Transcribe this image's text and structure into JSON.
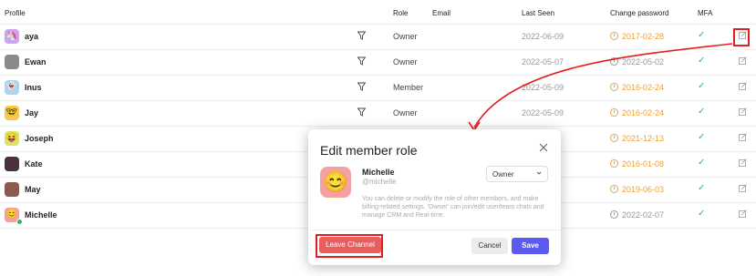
{
  "table": {
    "headers": {
      "profile": "Profile",
      "role": "Role",
      "email": "Email",
      "last_seen": "Last Seen",
      "change_password": "Change password",
      "mfa": "MFA"
    },
    "rows": [
      {
        "name": "aya",
        "avatar_icon": "unicorn-icon",
        "avatar_bg": "#c9a4f0",
        "glyph": "🦄",
        "role": "Owner",
        "last_seen": "2022-06-09",
        "password": "2017-02-28",
        "pwd_status": "orange",
        "mfa": "✓"
      },
      {
        "name": "Ewan",
        "avatar_icon": "photo-avatar",
        "avatar_bg": "#8a8a8a",
        "glyph": "",
        "role": "Owner",
        "last_seen": "2022-05-07",
        "password": "2022-05-02",
        "pwd_status": "grey",
        "mfa": "✓"
      },
      {
        "name": "Inus",
        "avatar_icon": "ghost-icon",
        "avatar_bg": "#a9d4f3",
        "glyph": "👻",
        "role": "Member",
        "last_seen": "2022-05-09",
        "password": "2016-02-24",
        "pwd_status": "orange",
        "mfa": "✓"
      },
      {
        "name": "Jay",
        "avatar_icon": "smiley-glasses-icon",
        "avatar_bg": "#f7c75a",
        "glyph": "🤓",
        "role": "Owner",
        "last_seen": "2022-05-09",
        "password": "2016-02-24",
        "pwd_status": "orange",
        "mfa": "✓"
      },
      {
        "name": "Joseph",
        "avatar_icon": "smiley-icon",
        "avatar_bg": "#d7e46a",
        "glyph": "😝",
        "role": "",
        "last_seen": "",
        "password": "2021-12-13",
        "pwd_status": "orange",
        "mfa": "✓"
      },
      {
        "name": "Kate",
        "avatar_icon": "photo-avatar",
        "avatar_bg": "#4a3140",
        "glyph": "",
        "role": "",
        "last_seen": "",
        "password": "2016-01-08",
        "pwd_status": "orange",
        "mfa": "✓"
      },
      {
        "name": "May",
        "avatar_icon": "photo-avatar",
        "avatar_bg": "#8a5a4a",
        "glyph": "",
        "role": "",
        "last_seen": "",
        "password": "2019-06-03",
        "pwd_status": "orange",
        "mfa": "✓"
      },
      {
        "name": "Michelle",
        "avatar_icon": "smiley-icon",
        "avatar_bg": "#f3a1a1",
        "glyph": "😊",
        "role": "",
        "last_seen": "",
        "password": "2022-02-07",
        "pwd_status": "grey",
        "mfa": "✓",
        "online": true
      }
    ]
  },
  "modal": {
    "title": "Edit member role",
    "member_name": "Michelle",
    "member_handle": "@michelle",
    "avatar_glyph": "😊",
    "role_select": "Owner",
    "description": "You can delete or modify the role of other members, and make billing-related settings. 'Owner' can join/edit user/team chats and manage CRM and Real-time.",
    "leave_label": "Leave Channel",
    "cancel_label": "Cancel",
    "save_label": "Save"
  },
  "colors": {
    "accent": "#5b5bf0",
    "danger": "#e85d5d",
    "highlight": "#e02020",
    "success": "#2bb673",
    "warning": "#f0a030"
  }
}
